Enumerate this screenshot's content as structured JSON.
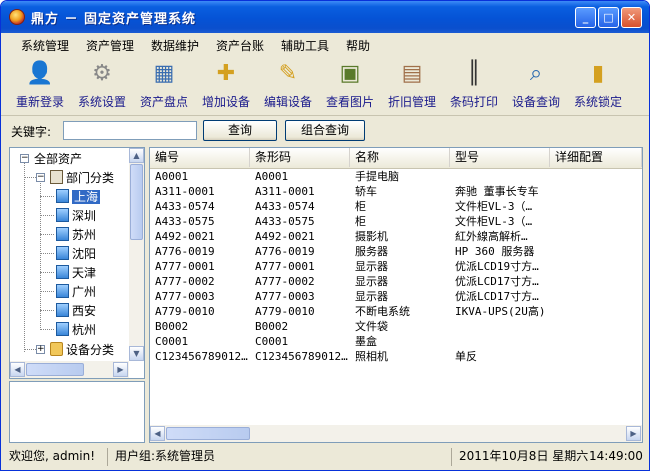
{
  "window": {
    "title": "鼎方 － 固定资产管理系统",
    "controls": {
      "minimize": "_",
      "maximize": "□",
      "close": "✕"
    }
  },
  "menu": [
    "系统管理",
    "资产管理",
    "数据维护",
    "资产台账",
    "辅助工具",
    "帮助"
  ],
  "toolbar": [
    {
      "label": "重新登录",
      "icon": "user-icon"
    },
    {
      "label": "系统设置",
      "icon": "gear-icon"
    },
    {
      "label": "资产盘点",
      "icon": "checklist-icon"
    },
    {
      "label": "增加设备",
      "icon": "add-note-icon"
    },
    {
      "label": "编辑设备",
      "icon": "edit-note-icon"
    },
    {
      "label": "查看图片",
      "icon": "picture-icon"
    },
    {
      "label": "折旧管理",
      "icon": "clipboard-icon"
    },
    {
      "label": "条码打印",
      "icon": "barcode-icon"
    },
    {
      "label": "设备查询",
      "icon": "magnifier-icon"
    },
    {
      "label": "系统锁定",
      "icon": "lock-icon"
    }
  ],
  "search": {
    "label": "关键字:",
    "value": "",
    "query_button": "查询",
    "combined_button": "组合查询"
  },
  "tree": {
    "root": "全部资产",
    "dept": "部门分类",
    "depts": [
      "上海",
      "深圳",
      "苏州",
      "沈阳",
      "天津",
      "广州",
      "西安",
      "杭州"
    ],
    "selected": "上海",
    "equip": "设备分类"
  },
  "grid": {
    "columns": [
      "编号",
      "条形码",
      "名称",
      "型号",
      "详细配置"
    ],
    "rows": [
      [
        "A0001",
        "A0001",
        "手提电脑",
        "",
        ""
      ],
      [
        "A311-0001",
        "A311-0001",
        "轿车",
        "奔驰 董事长专车",
        ""
      ],
      [
        "A433-0574",
        "A433-0574",
        "柜",
        "文件柜VL-3（…",
        ""
      ],
      [
        "A433-0575",
        "A433-0575",
        "柜",
        "文件柜VL-3（…",
        ""
      ],
      [
        "A492-0021",
        "A492-0021",
        "摄影机",
        "紅外線高解析…",
        ""
      ],
      [
        "A776-0019",
        "A776-0019",
        "服务器",
        "HP 360 服务器",
        ""
      ],
      [
        "A777-0001",
        "A777-0001",
        "显示器",
        "优派LCD19寸方…",
        ""
      ],
      [
        "A777-0002",
        "A777-0002",
        "显示器",
        "优派LCD17寸方…",
        ""
      ],
      [
        "A777-0003",
        "A777-0003",
        "显示器",
        "优派LCD17寸方…",
        ""
      ],
      [
        "A779-0010",
        "A779-0010",
        "不断电系统",
        "IKVA-UPS(2U高)",
        ""
      ],
      [
        "B0002",
        "B0002",
        "文件袋",
        "",
        ""
      ],
      [
        "C0001",
        "C0001",
        "墨盒",
        "",
        ""
      ],
      [
        "C123456789012…",
        "C123456789012…",
        "照相机",
        "单反",
        ""
      ]
    ]
  },
  "status": {
    "welcome": "欢迎您, admin!",
    "usergroup": "用户组:系统管理员",
    "date": "2011年10月8日 星期六",
    "time": "14:49:00"
  }
}
